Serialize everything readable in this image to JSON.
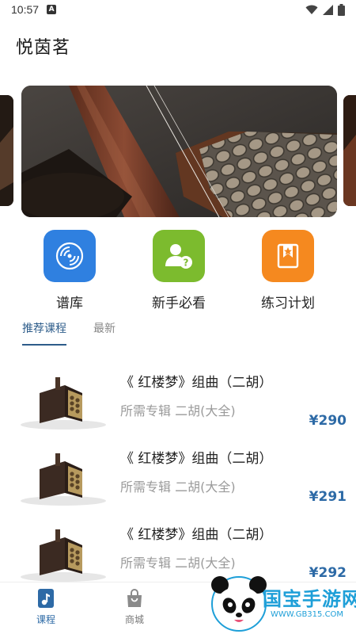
{
  "status_bar": {
    "time": "10:57",
    "notif_glyph": "A",
    "icons": [
      "wifi-icon",
      "signal-icon",
      "battery-icon"
    ]
  },
  "app": {
    "title": "悦茵茗"
  },
  "quick_actions": [
    {
      "label": "谱库",
      "icon": "record-disc-icon",
      "color": "#2f80e0"
    },
    {
      "label": "新手必看",
      "icon": "user-help-icon",
      "color": "#7cbb2e"
    },
    {
      "label": "练习计划",
      "icon": "bookmark-star-icon",
      "color": "#f5891f"
    }
  ],
  "tabs": [
    {
      "label": "推荐课程",
      "active": true
    },
    {
      "label": "最新",
      "active": false
    }
  ],
  "courses": [
    {
      "title": "《 红楼梦》组曲（二胡）",
      "subtitle": "所需专辑 二胡(大全)",
      "price": "¥290"
    },
    {
      "title": "《 红楼梦》组曲（二胡）",
      "subtitle": "所需专辑 二胡(大全)",
      "price": "¥291"
    },
    {
      "title": "《 红楼梦》组曲（二胡）",
      "subtitle": "所需专辑 二胡(大全)",
      "price": "¥292"
    }
  ],
  "bottom_nav": [
    {
      "label": "课程",
      "icon": "music-doc-icon",
      "active": true
    },
    {
      "label": "商城",
      "icon": "shopping-bag-icon",
      "active": false
    }
  ],
  "watermark": {
    "text": "国宝手游网",
    "url": "WWW.GB315.COM"
  },
  "colors": {
    "accent": "#2d6aa6",
    "tab_active": "#2d5c8a",
    "muted": "#9a9a9a"
  }
}
